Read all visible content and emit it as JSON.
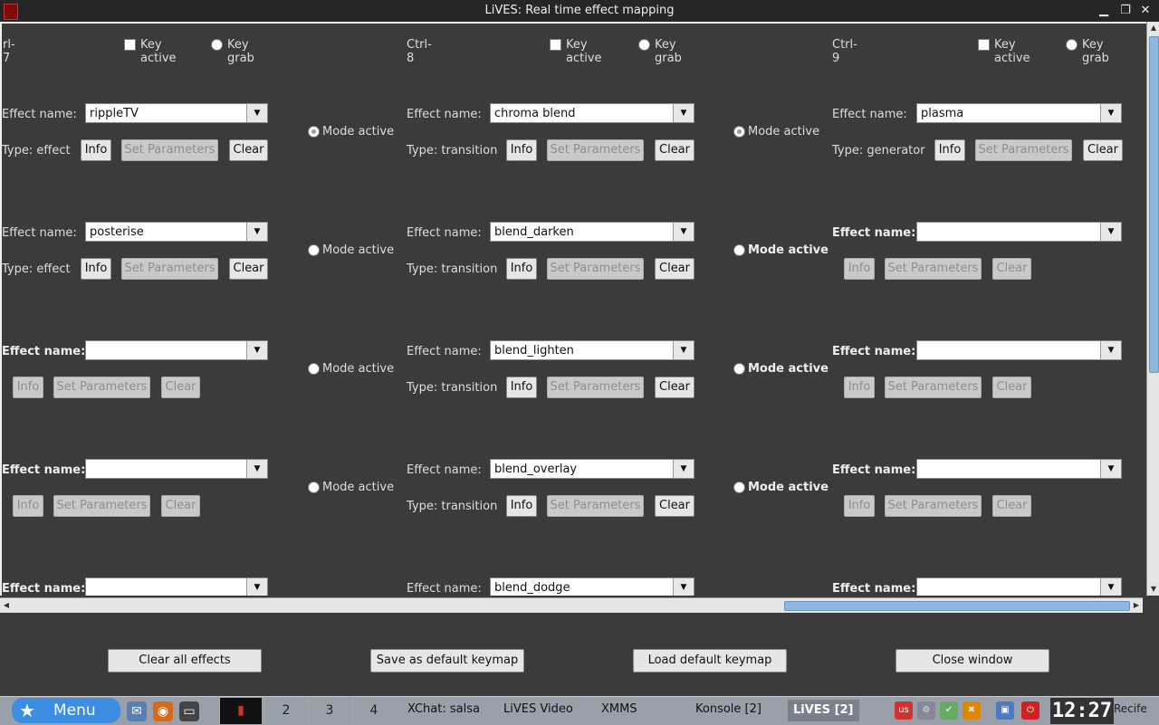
{
  "window": {
    "title": "LiVES: Real time effect mapping",
    "controls": {
      "minimize": "▁",
      "maximize": "❐",
      "close": "✕"
    }
  },
  "columns": [
    {
      "key": "rl-7",
      "key_active": "Key active",
      "key_grab": "Key grab",
      "rows": [
        {
          "label": "Effect name:",
          "effect": "rippleTV",
          "type": "Type: effect",
          "mode": "Mode active",
          "mode_on": true,
          "enabled": true
        },
        {
          "label": "Effect name:",
          "effect": "posterise",
          "type": "Type: effect",
          "mode": "Mode active",
          "mode_on": false,
          "enabled": true
        },
        {
          "label": "Effect name:",
          "effect": "",
          "type": "",
          "mode": "Mode active",
          "mode_on": false,
          "enabled": false
        },
        {
          "label": "Effect name:",
          "effect": "",
          "type": "",
          "mode": "Mode active",
          "mode_on": false,
          "enabled": false
        },
        {
          "label": "Effect name:",
          "effect": "",
          "type": "",
          "mode": "",
          "mode_on": false,
          "enabled": false
        }
      ]
    },
    {
      "key": "Ctrl-8",
      "key_active": "Key active",
      "key_grab": "Key grab",
      "rows": [
        {
          "label": "Effect name:",
          "effect": "chroma blend",
          "type": "Type: transition",
          "mode": "Mode active",
          "mode_on": true,
          "enabled": true
        },
        {
          "label": "Effect name:",
          "effect": "blend_darken",
          "type": "Type: transition",
          "mode": "Mode active",
          "mode_on": false,
          "enabled": true
        },
        {
          "label": "Effect name:",
          "effect": "blend_lighten",
          "type": "Type: transition",
          "mode": "Mode active",
          "mode_on": false,
          "enabled": true
        },
        {
          "label": "Effect name:",
          "effect": "blend_overlay",
          "type": "Type: transition",
          "mode": "Mode active",
          "mode_on": false,
          "enabled": true
        },
        {
          "label": "Effect name:",
          "effect": "blend_dodge",
          "type": "",
          "mode": "",
          "mode_on": false,
          "enabled": true
        }
      ]
    },
    {
      "key": "Ctrl-9",
      "key_active": "Key active",
      "key_grab": "Key grab",
      "rows": [
        {
          "label": "Effect name:",
          "effect": "plasma",
          "type": "Type: generator",
          "enabled": true
        },
        {
          "label": "Effect name:",
          "effect": "",
          "type": "",
          "enabled": false
        },
        {
          "label": "Effect name:",
          "effect": "",
          "type": "",
          "enabled": false
        },
        {
          "label": "Effect name:",
          "effect": "",
          "type": "",
          "enabled": false
        },
        {
          "label": "Effect name:",
          "effect": "",
          "type": "",
          "enabled": false
        }
      ]
    }
  ],
  "buttons": {
    "info": "Info",
    "set_params": "Set Parameters",
    "clear": "Clear"
  },
  "bottom_buttons": {
    "clear_all": "Clear all effects",
    "save_default": "Save as default keymap",
    "load_default": "Load default keymap",
    "close": "Close window"
  },
  "taskbar": {
    "menu": "Menu",
    "desktops": [
      "2",
      "3",
      "4"
    ],
    "tasks": [
      "XChat: salsa",
      "LiVES Video",
      "XMMS",
      "Konsole [2]",
      "LiVES [2]"
    ],
    "clock": "12:27",
    "city": "Recife"
  }
}
